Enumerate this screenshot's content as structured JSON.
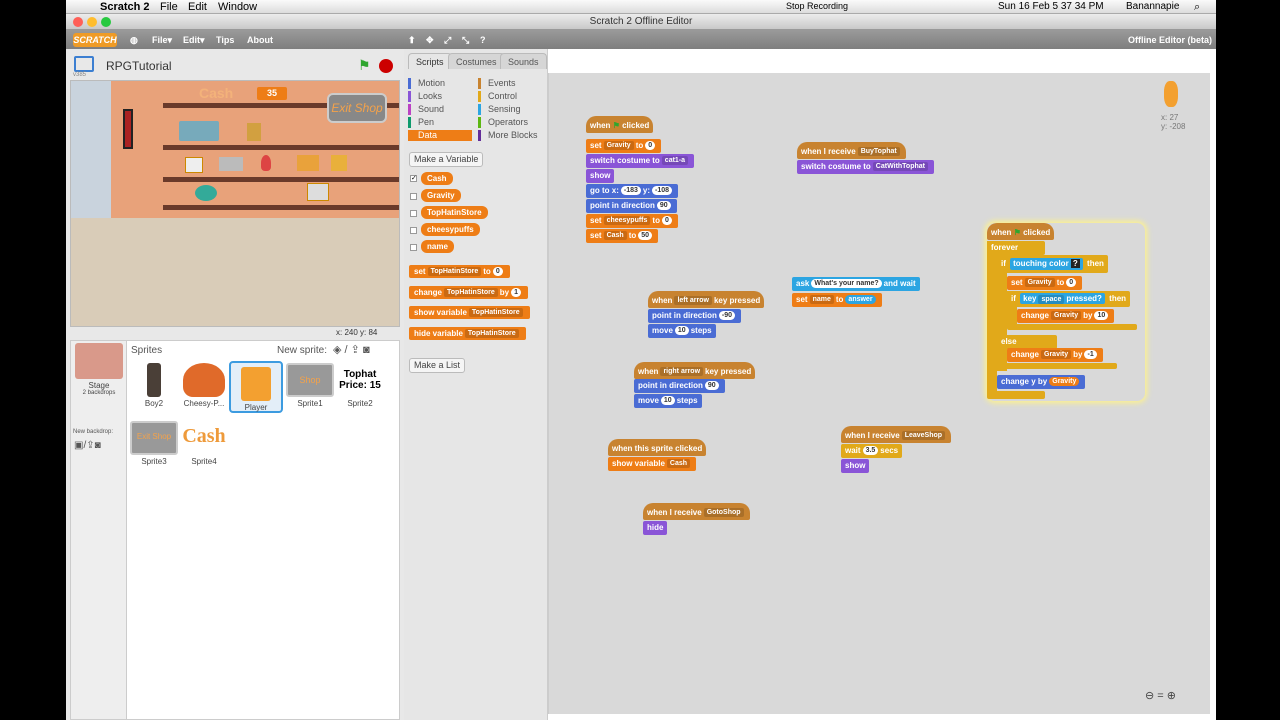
{
  "os": {
    "menus": [
      "Scratch 2",
      "File",
      "Edit",
      "Window"
    ],
    "status": [
      "Stop Recording",
      "Sun 16 Feb  5 37 34 PM",
      "Banannapie"
    ],
    "window_title": "Scratch 2 Offline Editor"
  },
  "toolbar": {
    "logo": "SCRATCH",
    "menus": [
      "File▾",
      "Edit▾",
      "Tips",
      "About"
    ],
    "right": "Offline Editor (beta)"
  },
  "stage": {
    "project_name": "RPGTutorial",
    "version": "v385",
    "cash_label": "Cash",
    "cash_value": "35",
    "exit_label": "Exit Shop",
    "coords": "x: 240  y: 84"
  },
  "sprites": {
    "header": "Sprites",
    "new_sprite": "New sprite:",
    "stage_label": "Stage",
    "backdrops": "2 backdrops",
    "new_backdrop": "New backdrop:",
    "items": [
      {
        "name": "Boy2"
      },
      {
        "name": "Cheesy-P..."
      },
      {
        "name": "Player"
      },
      {
        "name": "Sprite1"
      },
      {
        "name": "Sprite2"
      },
      {
        "name": "Sprite3"
      },
      {
        "name": "Sprite4"
      }
    ],
    "tophat_text": "Tophat Price: 15",
    "cash_text": "Cash",
    "shop_text": "Shop",
    "exit_text": "Exit Shop"
  },
  "tabs": [
    "Scripts",
    "Costumes",
    "Sounds"
  ],
  "categories": [
    "Motion",
    "Looks",
    "Sound",
    "Pen",
    "Data",
    "Events",
    "Control",
    "Sensing",
    "Operators",
    "More Blocks"
  ],
  "palette": {
    "make_variable": "Make a Variable",
    "variables": [
      "Cash",
      "Gravity",
      "TopHatinStore",
      "cheesypuffs",
      "name"
    ],
    "blocks": [
      "set",
      "TopHatinStore",
      "to",
      "0",
      "change",
      "TopHatinStore",
      "by",
      "1",
      "show variable",
      "TopHatinStore",
      "hide variable",
      "TopHatinStore"
    ],
    "make_list": "Make a List"
  },
  "scripts": {
    "sprite_xy": "x: 27\ny: -208",
    "s1": [
      "when",
      "clicked",
      "set",
      "Gravity",
      "to",
      "0",
      "switch costume to",
      "cat1-a",
      "show",
      "go to x:",
      "-183",
      "y:",
      "-108",
      "point in direction",
      "90",
      "set",
      "cheesypuffs",
      "to",
      "0",
      "set",
      "Cash",
      "to",
      "50"
    ],
    "s2": [
      "when I receive",
      "BuyTophat",
      "switch costume to",
      "CatWithTophat"
    ],
    "s3": [
      "when",
      "left arrow",
      "key pressed",
      "point in direction",
      "-90",
      "move",
      "10",
      "steps"
    ],
    "s4": [
      "when",
      "right arrow",
      "key pressed",
      "point in direction",
      "90",
      "move",
      "10",
      "steps"
    ],
    "s5": [
      "ask",
      "What's your name?",
      "and wait",
      "set",
      "name",
      "to",
      "answer"
    ],
    "s6": [
      "when",
      "clicked",
      "forever",
      "if",
      "touching color",
      "?",
      "then",
      "set",
      "Gravity",
      "to",
      "0",
      "if",
      "key",
      "space",
      "pressed?",
      "then",
      "change",
      "Gravity",
      "by",
      "10",
      "else",
      "change",
      "Gravity",
      "by",
      "-1",
      "change y by",
      "Gravity"
    ],
    "s7": [
      "when this sprite clicked",
      "show variable",
      "Cash"
    ],
    "s8": [
      "when I receive",
      "LeaveShop",
      "wait",
      "3.5",
      "secs",
      "show"
    ],
    "s9": [
      "when I receive",
      "GotoShop",
      "hide"
    ]
  }
}
